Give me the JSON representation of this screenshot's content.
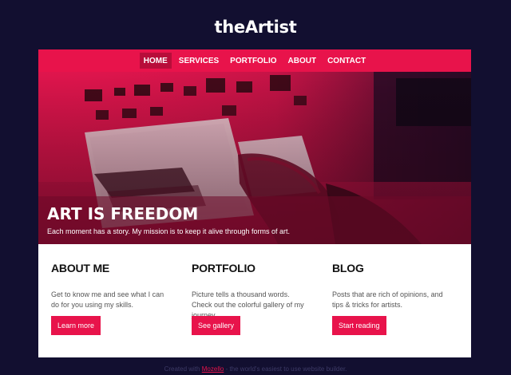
{
  "site": {
    "title": "theArtist"
  },
  "nav": {
    "items": [
      {
        "label": "HOME",
        "active": true
      },
      {
        "label": "SERVICES",
        "active": false
      },
      {
        "label": "PORTFOLIO",
        "active": false
      },
      {
        "label": "ABOUT",
        "active": false
      },
      {
        "label": "CONTACT",
        "active": false
      }
    ]
  },
  "hero": {
    "heading": "ART IS FREEDOM",
    "subtitle": "Each moment has a story. My mission is to keep it alive through forms of art."
  },
  "columns": [
    {
      "title": "ABOUT ME",
      "text": "Get to know me and see what I can do for you using my skills.",
      "button": "Learn more"
    },
    {
      "title": "PORTFOLIO",
      "text": "Picture tells a thousand words. Check out the colorful gallery of my journey.",
      "button": "See gallery"
    },
    {
      "title": "BLOG",
      "text": "Posts that are rich of opinions, and tips & tricks for artists.",
      "button": "Start reading"
    }
  ],
  "footer": {
    "prefix": "Created with",
    "link": "Mozello",
    "suffix": "- the world's easiest to use website builder."
  },
  "colors": {
    "accent": "#e8134b",
    "background": "#120f30",
    "hero_tint": "#e0154d"
  }
}
